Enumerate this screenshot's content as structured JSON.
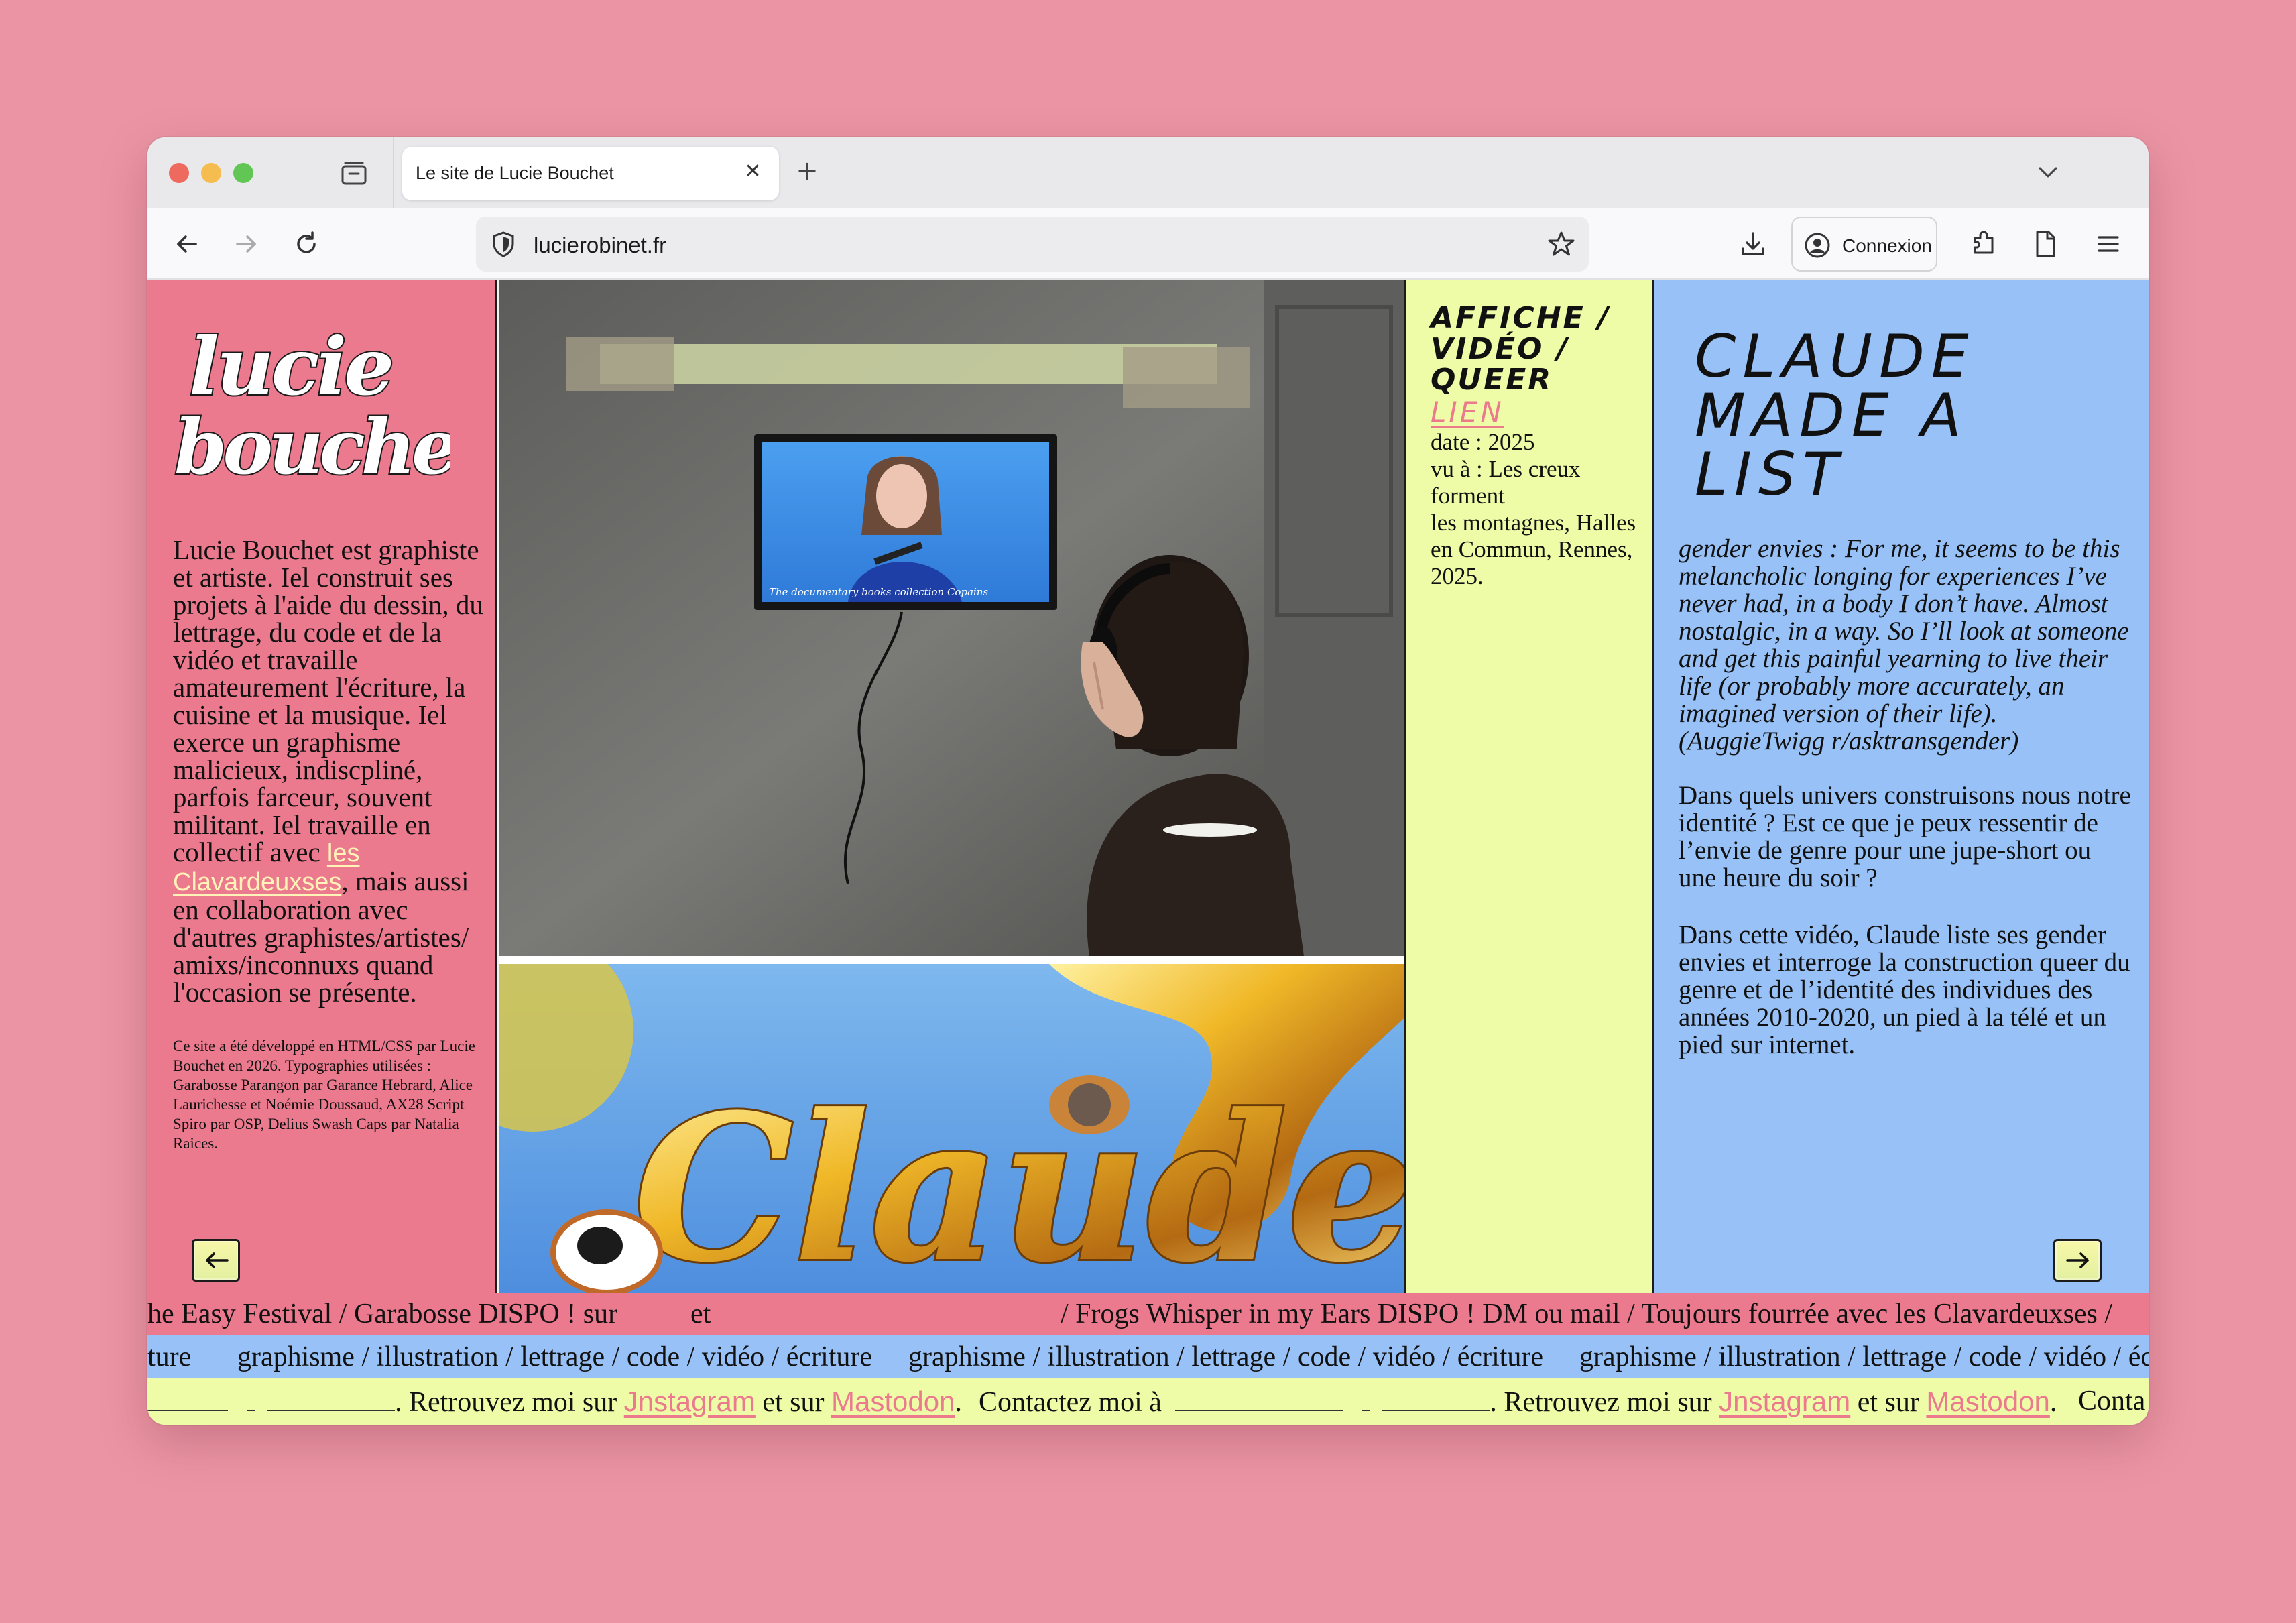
{
  "browser": {
    "tab_title": "Le site de Lucie Bouchet",
    "tab_close": "✕",
    "new_tab": "+",
    "url": "lucierobinet.fr",
    "connexion_label": "Connexion"
  },
  "icons": [
    "tab-overview-icon",
    "back-icon",
    "forward-icon",
    "reload-icon",
    "shield-icon",
    "star-icon",
    "download-icon",
    "account-icon",
    "extensions-icon",
    "reader-icon",
    "menu-icon",
    "chevron-down-icon",
    "arrow-left-icon",
    "arrow-right-icon"
  ],
  "colors": {
    "pink": "#ec7a8f",
    "yellow": "#eefca8",
    "blue": "#98c2f7",
    "backdrop": "#eb95a4",
    "link_cream": "#fff3b8"
  },
  "sidebar": {
    "logo_line1": "lucie",
    "logo_line2": "bouchet",
    "bio_before_link": "Lucie Bouchet est graphiste et artiste. Iel construit ses projets à l'aide du dessin, du lettrage, du code et de la vidéo et travaille amateurement l'écriture, la cuisine et la musique. Iel exerce un graphisme malicieux, indiscpliné, parfois farceur, souvent militant. Iel travaille en collectif avec",
    "bio_link": "les Clavardeuxses",
    "bio_after_link": ", mais aussi en collaboration avec d'autres graphistes/artistes/ amixs/inconnuxs quand l'occasion se présente.",
    "credits": "Ce site a été développé en HTML/CSS par Lucie Bouchet en 2026. Typographies utilisées : Garabosse Parangon par Garance Hebrard, Alice Laurichesse et Noémie Doussaud, AX28 Script Spiro par OSP, Delius Swash Caps par Natalia Raices."
  },
  "gallery": {
    "tv_subtitle": "The documentary books collection Copains",
    "poster_word": "Claude"
  },
  "project": {
    "categories": "AFFICHE / VIDÉO / QUEER",
    "link_label": "LIEN",
    "meta_line1": "date : 2025",
    "meta_line2": "vu à : Les creux forment",
    "meta_line3": "les montagnes, Halles en Commun, Rennes, 2025.",
    "title": "CLAUDE MADE A LIST",
    "quote": "gender envies : For me, it seems to be this melancholic longing for experiences I’ve never had, in a body I don’t have. Almost nostalgic, in a way. So I’ll look at someone and get this painful yearning to live their life (or probably more accurately, an imagined version of their life). (AuggieTwigg r/asktransgender)",
    "para1": "Dans quels univers construisons nous notre identité ? Est ce que je peux ressentir de l’envie de genre pour une jupe-short ou une heure du soir ?",
    "para2": "Dans cette vidéo, Claude liste ses gender envies et interroge la construction queer du genre et de l’identité des individues des années 2010-2020, un pied à la télé et un pied sur internet."
  },
  "marquees": {
    "band1_a": "he Easy Festival / Garabosse DISPO ! sur",
    "band1_b": "et",
    "band1_c": "/ Frogs Whisper in my Ears DISPO ! DM ou mail / Toujours fourrée avec les Clavardeuxses /",
    "band2_a": "ture",
    "band2_b": "graphisme / illustration / lettrage / code / vidéo / écriture",
    "band2_c": "graphisme / illustration / lettrage / code / vidéo / écriture",
    "band2_d": "graphisme / illustration / lettrage / code / vidéo / écr",
    "band3_retrouvez": ". Retrouvez moi sur",
    "band3_instagram": "Jnstagram",
    "band3_et_sur": "et sur",
    "band3_mastodon": "Mastodon",
    "band3_dot": ".",
    "band3_contact": "Contactez moi à",
    "band3_contact_cut": "Conta"
  }
}
